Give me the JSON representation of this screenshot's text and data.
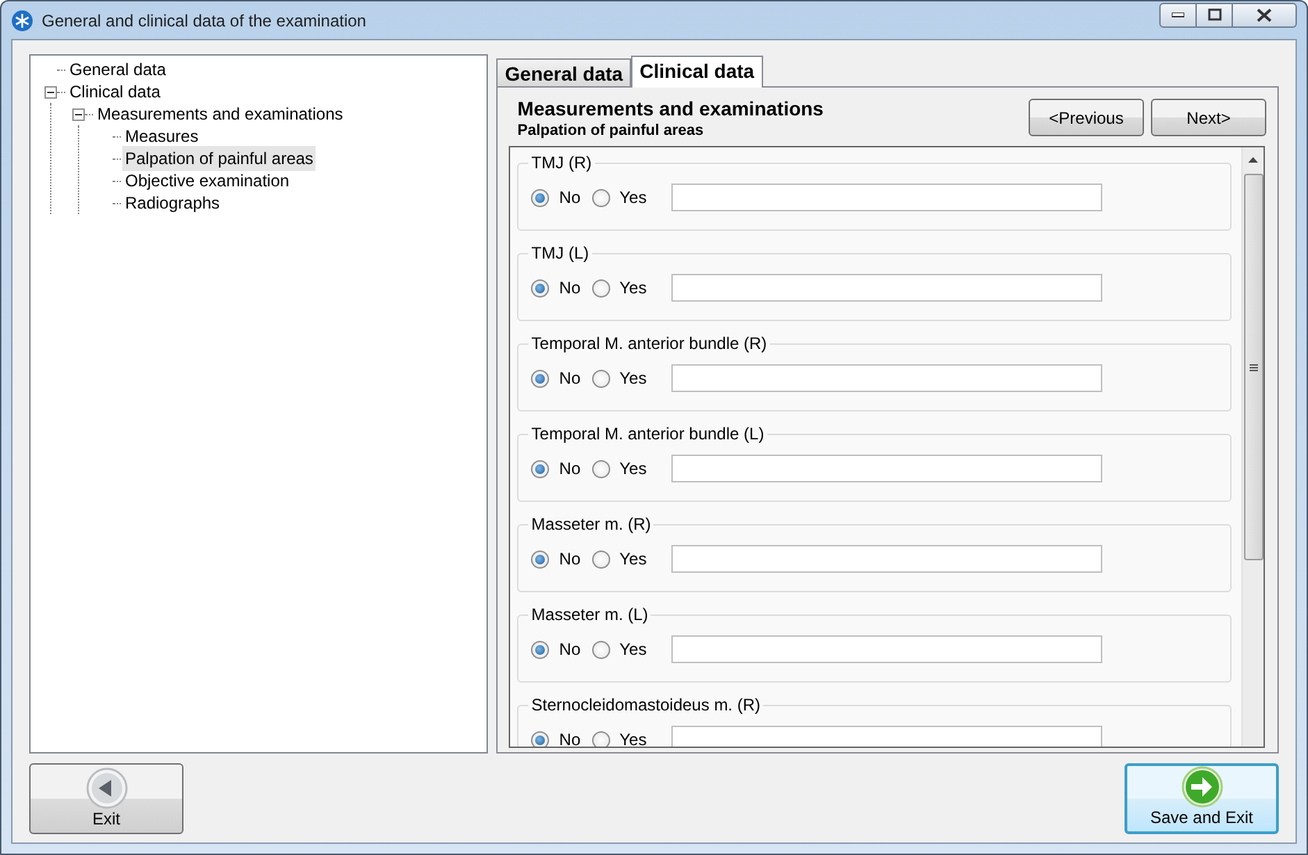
{
  "window": {
    "title": "General and clinical data of the examination"
  },
  "tree": [
    {
      "label": "General data",
      "selected": false
    },
    {
      "label": "Clinical data",
      "selected": false,
      "expanded": true,
      "children": [
        {
          "label": "Measurements and examinations",
          "selected": false,
          "expanded": true,
          "children": [
            {
              "label": "Measures",
              "selected": false
            },
            {
              "label": "Palpation of painful areas",
              "selected": true
            },
            {
              "label": "Objective examination",
              "selected": false
            },
            {
              "label": "Radiographs",
              "selected": false
            }
          ]
        }
      ]
    }
  ],
  "tabs": [
    {
      "label": "General data",
      "selected": false
    },
    {
      "label": "Clinical data",
      "selected": true
    }
  ],
  "section": {
    "title": "Measurements and examinations",
    "subtitle": "Palpation of painful areas"
  },
  "nav_buttons": [
    "<Previous",
    "Next>"
  ],
  "groups": [
    {
      "label": "TMJ (R)",
      "options": [
        {
          "label": "No",
          "selected": true
        },
        {
          "label": "Yes",
          "selected": false
        }
      ]
    },
    {
      "label": "TMJ (L)",
      "options": [
        {
          "label": "No",
          "selected": true
        },
        {
          "label": "Yes",
          "selected": false
        }
      ]
    },
    {
      "label": "Temporal M. anterior bundle (R)",
      "options": [
        {
          "label": "No",
          "selected": true
        },
        {
          "label": "Yes",
          "selected": false
        }
      ]
    },
    {
      "label": "Temporal M. anterior bundle (L)",
      "options": [
        {
          "label": "No",
          "selected": true
        },
        {
          "label": "Yes",
          "selected": false
        }
      ]
    },
    {
      "label": "Masseter m. (R)",
      "options": [
        {
          "label": "No",
          "selected": true
        },
        {
          "label": "Yes",
          "selected": false
        }
      ]
    },
    {
      "label": "Masseter m. (L)",
      "options": [
        {
          "label": "No",
          "selected": true
        },
        {
          "label": "Yes",
          "selected": false
        }
      ]
    },
    {
      "label": "Sternocleidomastoideus m. (R)",
      "options": [
        {
          "label": "No",
          "selected": true
        },
        {
          "label": "Yes",
          "selected": false
        }
      ]
    }
  ],
  "footer": {
    "exit": "Exit",
    "save": "Save and Exit"
  }
}
